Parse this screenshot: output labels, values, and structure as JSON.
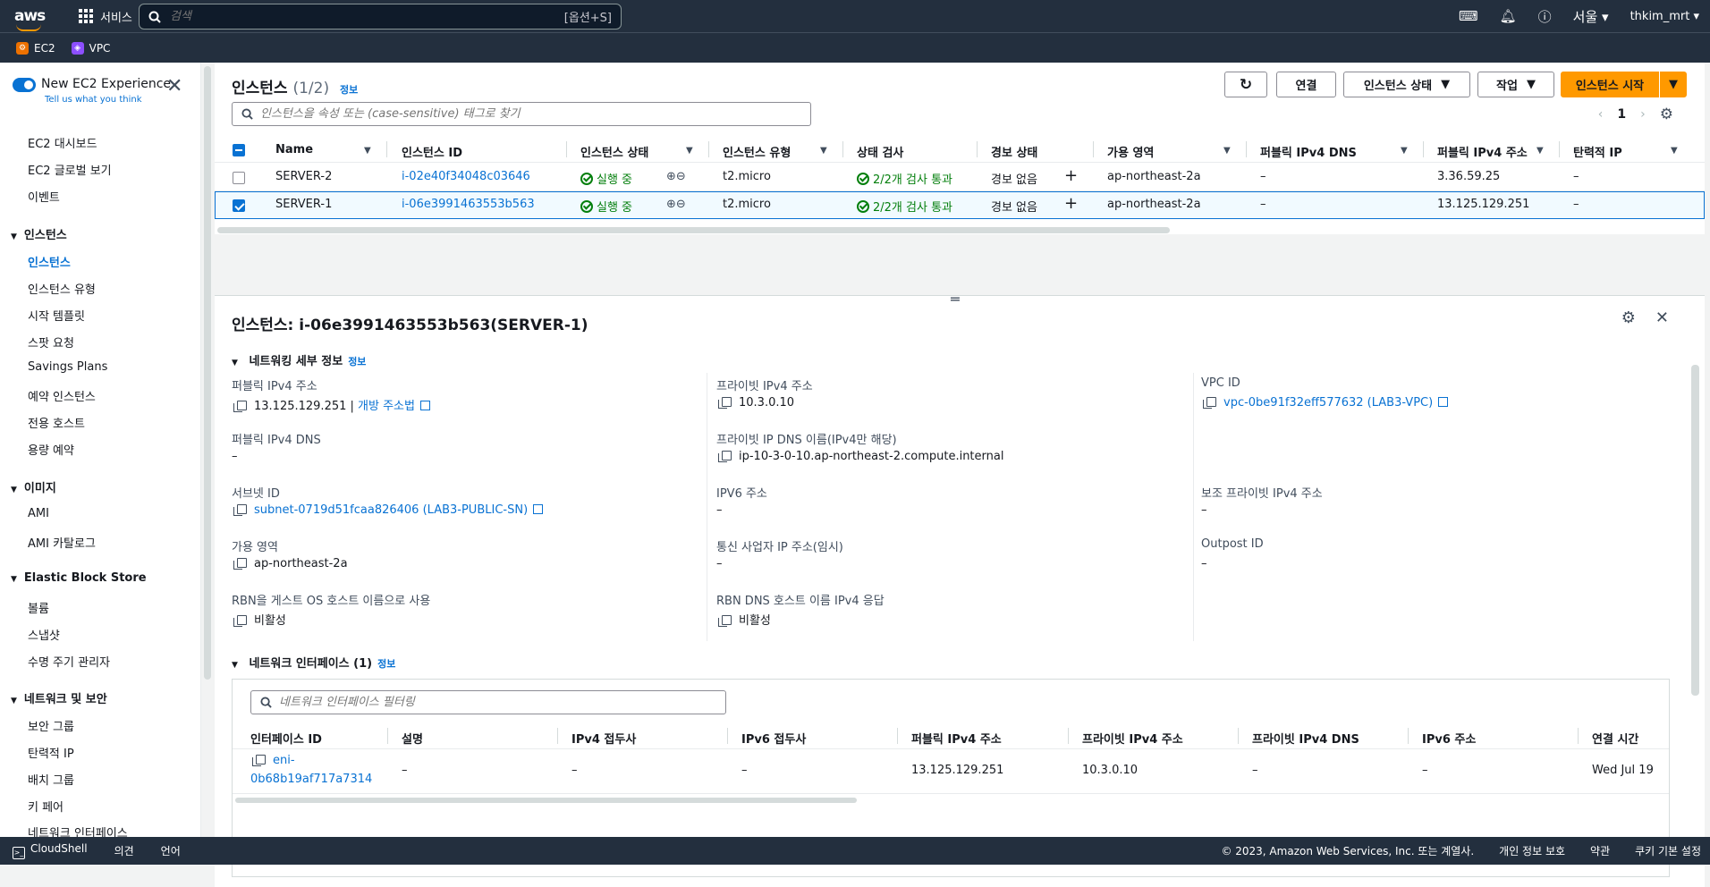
{
  "topnav": {
    "logo": "aws",
    "services": "서비스",
    "search_placeholder": "검색",
    "search_hint": "[옵션+S]",
    "region": "서울",
    "user": "thkim_mrt"
  },
  "favorites": [
    {
      "label": "EC2",
      "color": "#ed7100"
    },
    {
      "label": "VPC",
      "color": "#8c4fff"
    }
  ],
  "sidebar": {
    "new_exp": "New EC2 Experience",
    "new_exp_sub": "Tell us what you think",
    "top_items": [
      "EC2 대시보드",
      "EC2 글로벌 보기",
      "이벤트"
    ],
    "sections": [
      {
        "title": "인스턴스",
        "items": [
          "인스턴스",
          "인스턴스 유형",
          "시작 템플릿",
          "스팟 요청",
          "Savings Plans",
          "예약 인스턴스",
          "전용 호스트",
          "용량 예약"
        ]
      },
      {
        "title": "이미지",
        "items": [
          "AMI",
          "AMI 카탈로그"
        ]
      },
      {
        "title": "Elastic Block Store",
        "items": [
          "볼륨",
          "스냅샷",
          "수명 주기 관리자"
        ]
      },
      {
        "title": "네트워크 및 보안",
        "items": [
          "보안 그룹",
          "탄력적 IP",
          "배치 그룹",
          "키 페어",
          "네트워크 인터페이스"
        ]
      }
    ]
  },
  "instances": {
    "title": "인스턴스",
    "count": "(1/2)",
    "info": "정보",
    "btn_connect": "연결",
    "btn_state": "인스턴스 상태",
    "btn_actions": "작업",
    "btn_launch": "인스턴스 시작",
    "filter_placeholder": "인스턴스을 속성 또는 (case-sensitive) 태그로 찾기",
    "page": "1",
    "columns": [
      "Name",
      "인스턴스 ID",
      "인스턴스 상태",
      "인스턴스 유형",
      "상태 검사",
      "경보 상태",
      "가용 영역",
      "퍼블릭 IPv4 DNS",
      "퍼블릭 IPv4 주소",
      "탄력적 IP"
    ],
    "rows": [
      {
        "name": "SERVER-2",
        "id": "i-02e40f34048c03646",
        "state": "실행 중",
        "type": "t2.micro",
        "check": "2/2개 검사 통과",
        "alarm": "경보 없음",
        "az": "ap-northeast-2a",
        "dns": "–",
        "ip": "3.36.59.25",
        "eip": "–"
      },
      {
        "name": "SERVER-1",
        "id": "i-06e3991463553b563",
        "state": "실행 중",
        "type": "t2.micro",
        "check": "2/2개 검사 통과",
        "alarm": "경보 없음",
        "az": "ap-northeast-2a",
        "dns": "–",
        "ip": "13.125.129.251",
        "eip": "–"
      }
    ]
  },
  "detail": {
    "title": "인스턴스: i-06e3991463553b563(SERVER-1)",
    "net_section": "네트워킹 세부 정보",
    "info": "정보",
    "pub_ip_label": "퍼블릭 IPv4 주소",
    "pub_ip": "13.125.129.251",
    "open_addr": "개방 주소법",
    "priv_ip_label": "프라이빗 IPv4 주소",
    "priv_ip": "10.3.0.10",
    "vpc_label": "VPC ID",
    "vpc": "vpc-0be91f32eff577632 (LAB3-VPC)",
    "pub_dns_label": "퍼블릭 IPv4 DNS",
    "pub_dns": "–",
    "priv_dns_label": "프라이빗 IP DNS 이름(IPv4만 해당)",
    "priv_dns": "ip-10-3-0-10.ap-northeast-2.compute.internal",
    "subnet_label": "서브넷 ID",
    "subnet": "subnet-0719d51fcaa826406 (LAB3-PUBLIC-SN)",
    "ipv6_label": "IPV6 주소",
    "ipv6": "–",
    "sec_priv_label": "보조 프라이빗 IPv4 주소",
    "sec_priv": "–",
    "az_label": "가용 영역",
    "az": "ap-northeast-2a",
    "carrier_label": "통신 사업자 IP 주소(임시)",
    "carrier": "–",
    "outpost_label": "Outpost ID",
    "outpost": "–",
    "rbn_label": "RBN을 게스트 OS 호스트 이름으로 사용",
    "rbn": "비활성",
    "rbn_dns_label": "RBN DNS 호스트 이름 IPv4 응답",
    "rbn_dns": "비활성",
    "eni_section": "네트워크 인터페이스 (1)",
    "eni_filter": "네트워크 인터페이스 필터링",
    "eni_columns": [
      "인터페이스 ID",
      "설명",
      "IPv4 접두사",
      "IPv6 접두사",
      "퍼블릭 IPv4 주소",
      "프라이빗 IPv4 주소",
      "프라이빗 IPv4 DNS",
      "IPv6 주소",
      "연결 시간"
    ],
    "eni_row": {
      "id1": "eni-",
      "id2": "0b68b19af717a7314",
      "desc": "–",
      "v4p": "–",
      "v6p": "–",
      "pub": "13.125.129.251",
      "priv": "10.3.0.10",
      "dns": "–",
      "v6": "–",
      "time": "Wed Jul 19"
    }
  },
  "footer": {
    "cloudshell": "CloudShell",
    "feedback": "의견",
    "language": "언어",
    "copyright": "© 2023, Amazon Web Services, Inc. 또는 계열사.",
    "privacy": "개인 정보 보호",
    "terms": "약관",
    "cookies": "쿠키 기본 설정"
  }
}
